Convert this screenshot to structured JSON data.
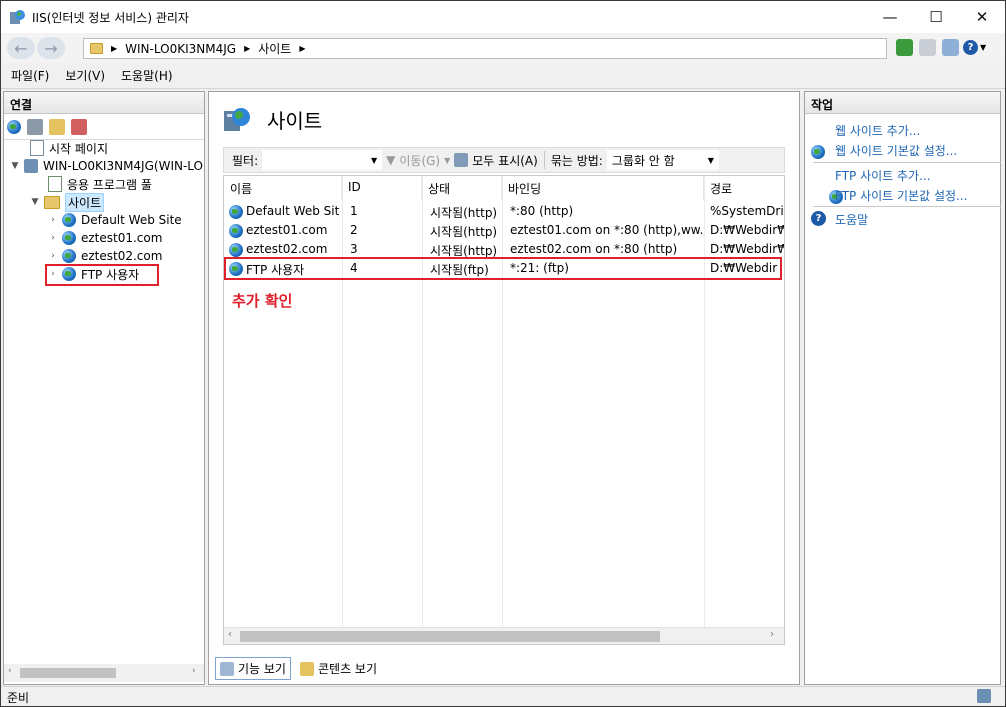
{
  "window": {
    "title": "IIS(인터넷 정보 서비스) 관리자",
    "minimize": "—",
    "maximize": "☐",
    "close": "✕"
  },
  "address": {
    "segments": [
      "WIN-LO0KI3NM4JG",
      "사이트"
    ]
  },
  "menu": [
    "파일(F)",
    "보기(V)",
    "도움말(H)"
  ],
  "connections": {
    "header": "연결",
    "tree": [
      {
        "label": "시작 페이지"
      },
      {
        "label": "WIN-LO0KI3NM4JG(WIN-LO"
      },
      {
        "label": "응용 프로그램 풀"
      },
      {
        "label": "사이트"
      },
      {
        "label": "Default Web Site"
      },
      {
        "label": "eztest01.com"
      },
      {
        "label": "eztest02.com"
      },
      {
        "label": "FTP 사용자"
      }
    ]
  },
  "main": {
    "title": "사이트",
    "filter_label": "필터:",
    "go_label": "이동(G)",
    "show_all_label": "모두 표시(A)",
    "group_by_label": "묶는 방법:",
    "group_by_value": "그룹화 안 함",
    "columns": [
      "이름",
      "ID",
      "상태",
      "바인딩",
      "경로"
    ],
    "rows": [
      [
        "Default Web Site",
        "1",
        "시작됨(http)",
        "*:80 (http)",
        "%SystemDrive"
      ],
      [
        "eztest01.com",
        "2",
        "시작됨(http)",
        "eztest01.com on *:80 (http),ww...",
        "D:₩Webdir₩e"
      ],
      [
        "eztest02.com",
        "3",
        "시작됨(http)",
        "eztest02.com on *:80 (http)",
        "D:₩Webdir₩e"
      ],
      [
        "FTP 사용자",
        "4",
        "시작됨(ftp)",
        "*:21: (ftp)",
        "D:₩Webdir"
      ]
    ],
    "annotation": "추가 확인",
    "tab_features": "기능 보기",
    "tab_content": "콘텐츠 보기"
  },
  "actions": {
    "header": "작업",
    "items": [
      "웹 사이트 추가...",
      "웹 사이트 기본값 설정...",
      "FTP 사이트 추가...",
      "FTP 사이트 기본값 설정...",
      "도움말"
    ]
  },
  "status": {
    "text": "준비"
  },
  "colors": {
    "accent": "#1f66b5",
    "highlight": "#e0202a",
    "selection": "#cce8ff"
  }
}
